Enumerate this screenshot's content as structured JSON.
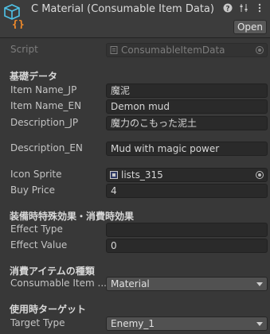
{
  "header": {
    "title": "C Material (Consumable Item Data)",
    "open_label": "Open",
    "icons": [
      "help-icon",
      "settings-sliders-icon",
      "more-options-icon"
    ]
  },
  "script": {
    "label": "Script",
    "value": "ConsumableItemData"
  },
  "sections": {
    "basic": "基礎データ",
    "effect": "装備時特殊効果・消費時効果",
    "consumable_kind": "消費アイテムの種類",
    "target": "使用時ターゲット"
  },
  "fields": {
    "item_name_jp": {
      "label": "Item Name_JP",
      "value": "魔泥"
    },
    "item_name_en": {
      "label": "Item Name_EN",
      "value": "Demon mud"
    },
    "description_jp": {
      "label": "Description_JP",
      "value": "魔力のこもった泥土"
    },
    "description_en": {
      "label": "Description_EN",
      "value": "Mud with magic power"
    },
    "icon_sprite": {
      "label": "Icon Sprite",
      "value": "lists_315"
    },
    "buy_price": {
      "label": "Buy Price",
      "value": "4"
    },
    "effect_type": {
      "label": "Effect Type",
      "value": ""
    },
    "effect_value": {
      "label": "Effect Value",
      "value": "0"
    },
    "consumable_item": {
      "label": "Consumable Item ...",
      "value": "Material"
    },
    "target_type": {
      "label": "Target Type",
      "value": "Enemy_1"
    }
  },
  "colors": {
    "background": "#383838",
    "field_bg": "#2a2a2a",
    "dropdown_bg": "#515151",
    "icon_cyan": "#4fc3e8",
    "icon_orange": "#f08a2a"
  }
}
